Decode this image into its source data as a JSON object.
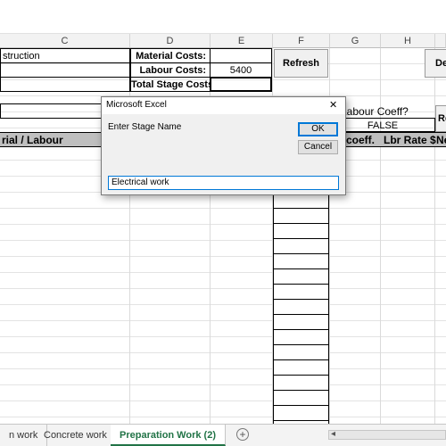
{
  "columns": [
    "C",
    "D",
    "E",
    "F",
    "G",
    "H"
  ],
  "sheet": {
    "c_title": "struction",
    "material_costs_label": "Material Costs:",
    "labour_costs_label": "Labour Costs:",
    "labour_costs_value": "5400",
    "total_stage_costs_label": "Total Stage Costs:",
    "refresh_button": "Refresh",
    "de_button": "De",
    "re_button": "Re",
    "labour_coeff_label": "e Labour Coeff?",
    "labour_coeff_value": "FALSE",
    "header_material_labour": "rial / Labour",
    "header_coeff": "r coeff.",
    "header_lbr_rate": "Lbr Rate $",
    "header_ne": "Ne"
  },
  "dialog": {
    "title": "Microsoft Excel",
    "close_glyph": "✕",
    "prompt": "Enter Stage Name",
    "ok_label": "OK",
    "cancel_label": "Cancel",
    "input_value": "Electrical work"
  },
  "tabs": {
    "tab1": "n work",
    "tab2": "Concrete work",
    "tab3": "Preparation Work (2)",
    "add_glyph": "+",
    "nav_glyph": "◂"
  }
}
